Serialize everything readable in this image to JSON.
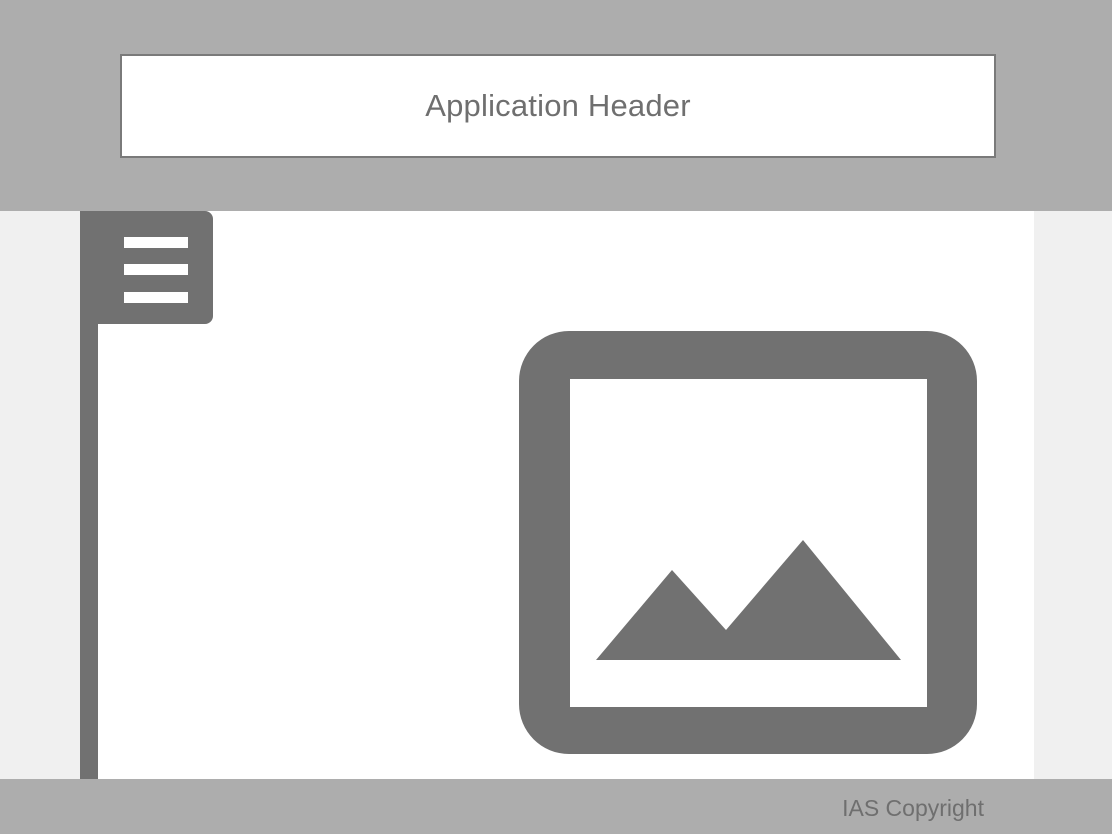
{
  "header": {
    "title": "Application Header"
  },
  "sidebar": {
    "menu_icon": "hamburger-menu-icon"
  },
  "main": {
    "image_icon": "image-placeholder-icon"
  },
  "footer": {
    "copyright": "IAS Copyright"
  },
  "colors": {
    "band_gray": "#adadad",
    "icon_gray": "#717171",
    "text_gray": "#6f6f6f",
    "background": "#f0f0f0",
    "content_white": "#ffffff"
  }
}
